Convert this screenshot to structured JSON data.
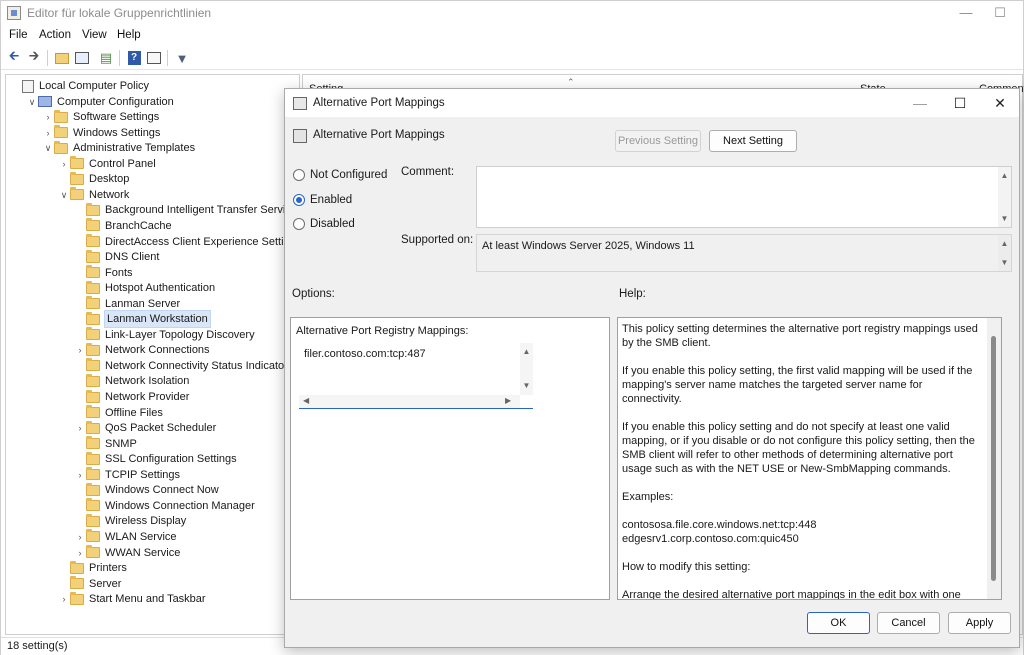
{
  "window": {
    "title": "Editor für lokale Gruppenrichtlinien",
    "min": "—",
    "max": "☐"
  },
  "menu": [
    "File",
    "Action",
    "View",
    "Help"
  ],
  "tree": [
    {
      "label": "Local Computer Policy",
      "level": 0,
      "icon": "doc",
      "exp": ""
    },
    {
      "label": "Computer Configuration",
      "level": 1,
      "icon": "pc",
      "exp": "v"
    },
    {
      "label": "Software Settings",
      "level": 2,
      "icon": "folder",
      "exp": ">"
    },
    {
      "label": "Windows Settings",
      "level": 2,
      "icon": "folder",
      "exp": ">"
    },
    {
      "label": "Administrative Templates",
      "level": 2,
      "icon": "folder",
      "exp": "v"
    },
    {
      "label": "Control Panel",
      "level": 3,
      "icon": "folder",
      "exp": ">"
    },
    {
      "label": "Desktop",
      "level": 3,
      "icon": "folder",
      "exp": ""
    },
    {
      "label": "Network",
      "level": 3,
      "icon": "folder",
      "exp": "v"
    },
    {
      "label": "Background Intelligent Transfer Service (BI",
      "level": 4,
      "icon": "folder",
      "exp": ""
    },
    {
      "label": "BranchCache",
      "level": 4,
      "icon": "folder",
      "exp": ""
    },
    {
      "label": "DirectAccess Client Experience Settings",
      "level": 4,
      "icon": "folder",
      "exp": ""
    },
    {
      "label": "DNS Client",
      "level": 4,
      "icon": "folder",
      "exp": ""
    },
    {
      "label": "Fonts",
      "level": 4,
      "icon": "folder",
      "exp": ""
    },
    {
      "label": "Hotspot Authentication",
      "level": 4,
      "icon": "folder",
      "exp": ""
    },
    {
      "label": "Lanman Server",
      "level": 4,
      "icon": "folder",
      "exp": ""
    },
    {
      "label": "Lanman Workstation",
      "level": 4,
      "icon": "folder",
      "exp": "",
      "selected": true
    },
    {
      "label": "Link-Layer Topology Discovery",
      "level": 4,
      "icon": "folder",
      "exp": ""
    },
    {
      "label": "Network Connections",
      "level": 4,
      "icon": "folder",
      "exp": ">"
    },
    {
      "label": "Network Connectivity Status Indicator",
      "level": 4,
      "icon": "folder",
      "exp": ""
    },
    {
      "label": "Network Isolation",
      "level": 4,
      "icon": "folder",
      "exp": ""
    },
    {
      "label": "Network Provider",
      "level": 4,
      "icon": "folder",
      "exp": ""
    },
    {
      "label": "Offline Files",
      "level": 4,
      "icon": "folder",
      "exp": ""
    },
    {
      "label": "QoS Packet Scheduler",
      "level": 4,
      "icon": "folder",
      "exp": ">"
    },
    {
      "label": "SNMP",
      "level": 4,
      "icon": "folder",
      "exp": ""
    },
    {
      "label": "SSL Configuration Settings",
      "level": 4,
      "icon": "folder",
      "exp": ""
    },
    {
      "label": "TCPIP Settings",
      "level": 4,
      "icon": "folder",
      "exp": ">"
    },
    {
      "label": "Windows Connect Now",
      "level": 4,
      "icon": "folder",
      "exp": ""
    },
    {
      "label": "Windows Connection Manager",
      "level": 4,
      "icon": "folder",
      "exp": ""
    },
    {
      "label": "Wireless Display",
      "level": 4,
      "icon": "folder",
      "exp": ""
    },
    {
      "label": "WLAN Service",
      "level": 4,
      "icon": "folder",
      "exp": ">"
    },
    {
      "label": "WWAN Service",
      "level": 4,
      "icon": "folder",
      "exp": ">"
    },
    {
      "label": "Printers",
      "level": 3,
      "icon": "folder",
      "exp": ""
    },
    {
      "label": "Server",
      "level": 3,
      "icon": "folder",
      "exp": ""
    },
    {
      "label": "Start Menu and Taskbar",
      "level": 3,
      "icon": "folder",
      "exp": ">"
    }
  ],
  "status": "18 setting(s)",
  "list": {
    "col_setting": "Setting",
    "col_state": "State",
    "col_comment": "Comment"
  },
  "dialog": {
    "title": "Alternative Port Mappings",
    "header_title": "Alternative Port Mappings",
    "prev_button": "Previous Setting",
    "next_button": "Next Setting",
    "radio_not_configured": "Not Configured",
    "radio_enabled": "Enabled",
    "radio_disabled": "Disabled",
    "comment_label": "Comment:",
    "supported_label": "Supported on:",
    "supported_value": "At least Windows Server 2025, Windows 11",
    "options_label": "Options:",
    "help_label": "Help:",
    "option_field_label": "Alternative Port Registry Mappings:",
    "option_field_value": "filer.contoso.com:tcp:487",
    "help_paragraphs": [
      "This policy setting determines the alternative port registry mappings used by the SMB client.",
      "If you enable this policy setting, the first valid mapping will be used if the mapping's server name matches the targeted server name for connectivity.",
      "If you enable this policy setting and do not specify at least one valid mapping, or if you disable or do not configure this policy setting, then the SMB client will refer to other methods of determining alternative port usage such as with the NET USE or New-SmbMapping commands.",
      "Examples:"
    ],
    "help_examples": [
      "contososa.file.core.windows.net:tcp:448",
      "edgesrv1.corp.contoso.com:quic450"
    ],
    "help_paragraphs_2": [
      "How to modify this setting:",
      "Arrange the desired alternative port mappings in the edit box with one mapping entry per line."
    ],
    "ok_button": "OK",
    "cancel_button": "Cancel",
    "apply_button": "Apply",
    "minimize": "—",
    "maximize": "☐",
    "close": "✕",
    "selected_radio": "enabled"
  },
  "colors": {
    "accent": "#2a64c9",
    "selection": "#d9e6f7"
  }
}
